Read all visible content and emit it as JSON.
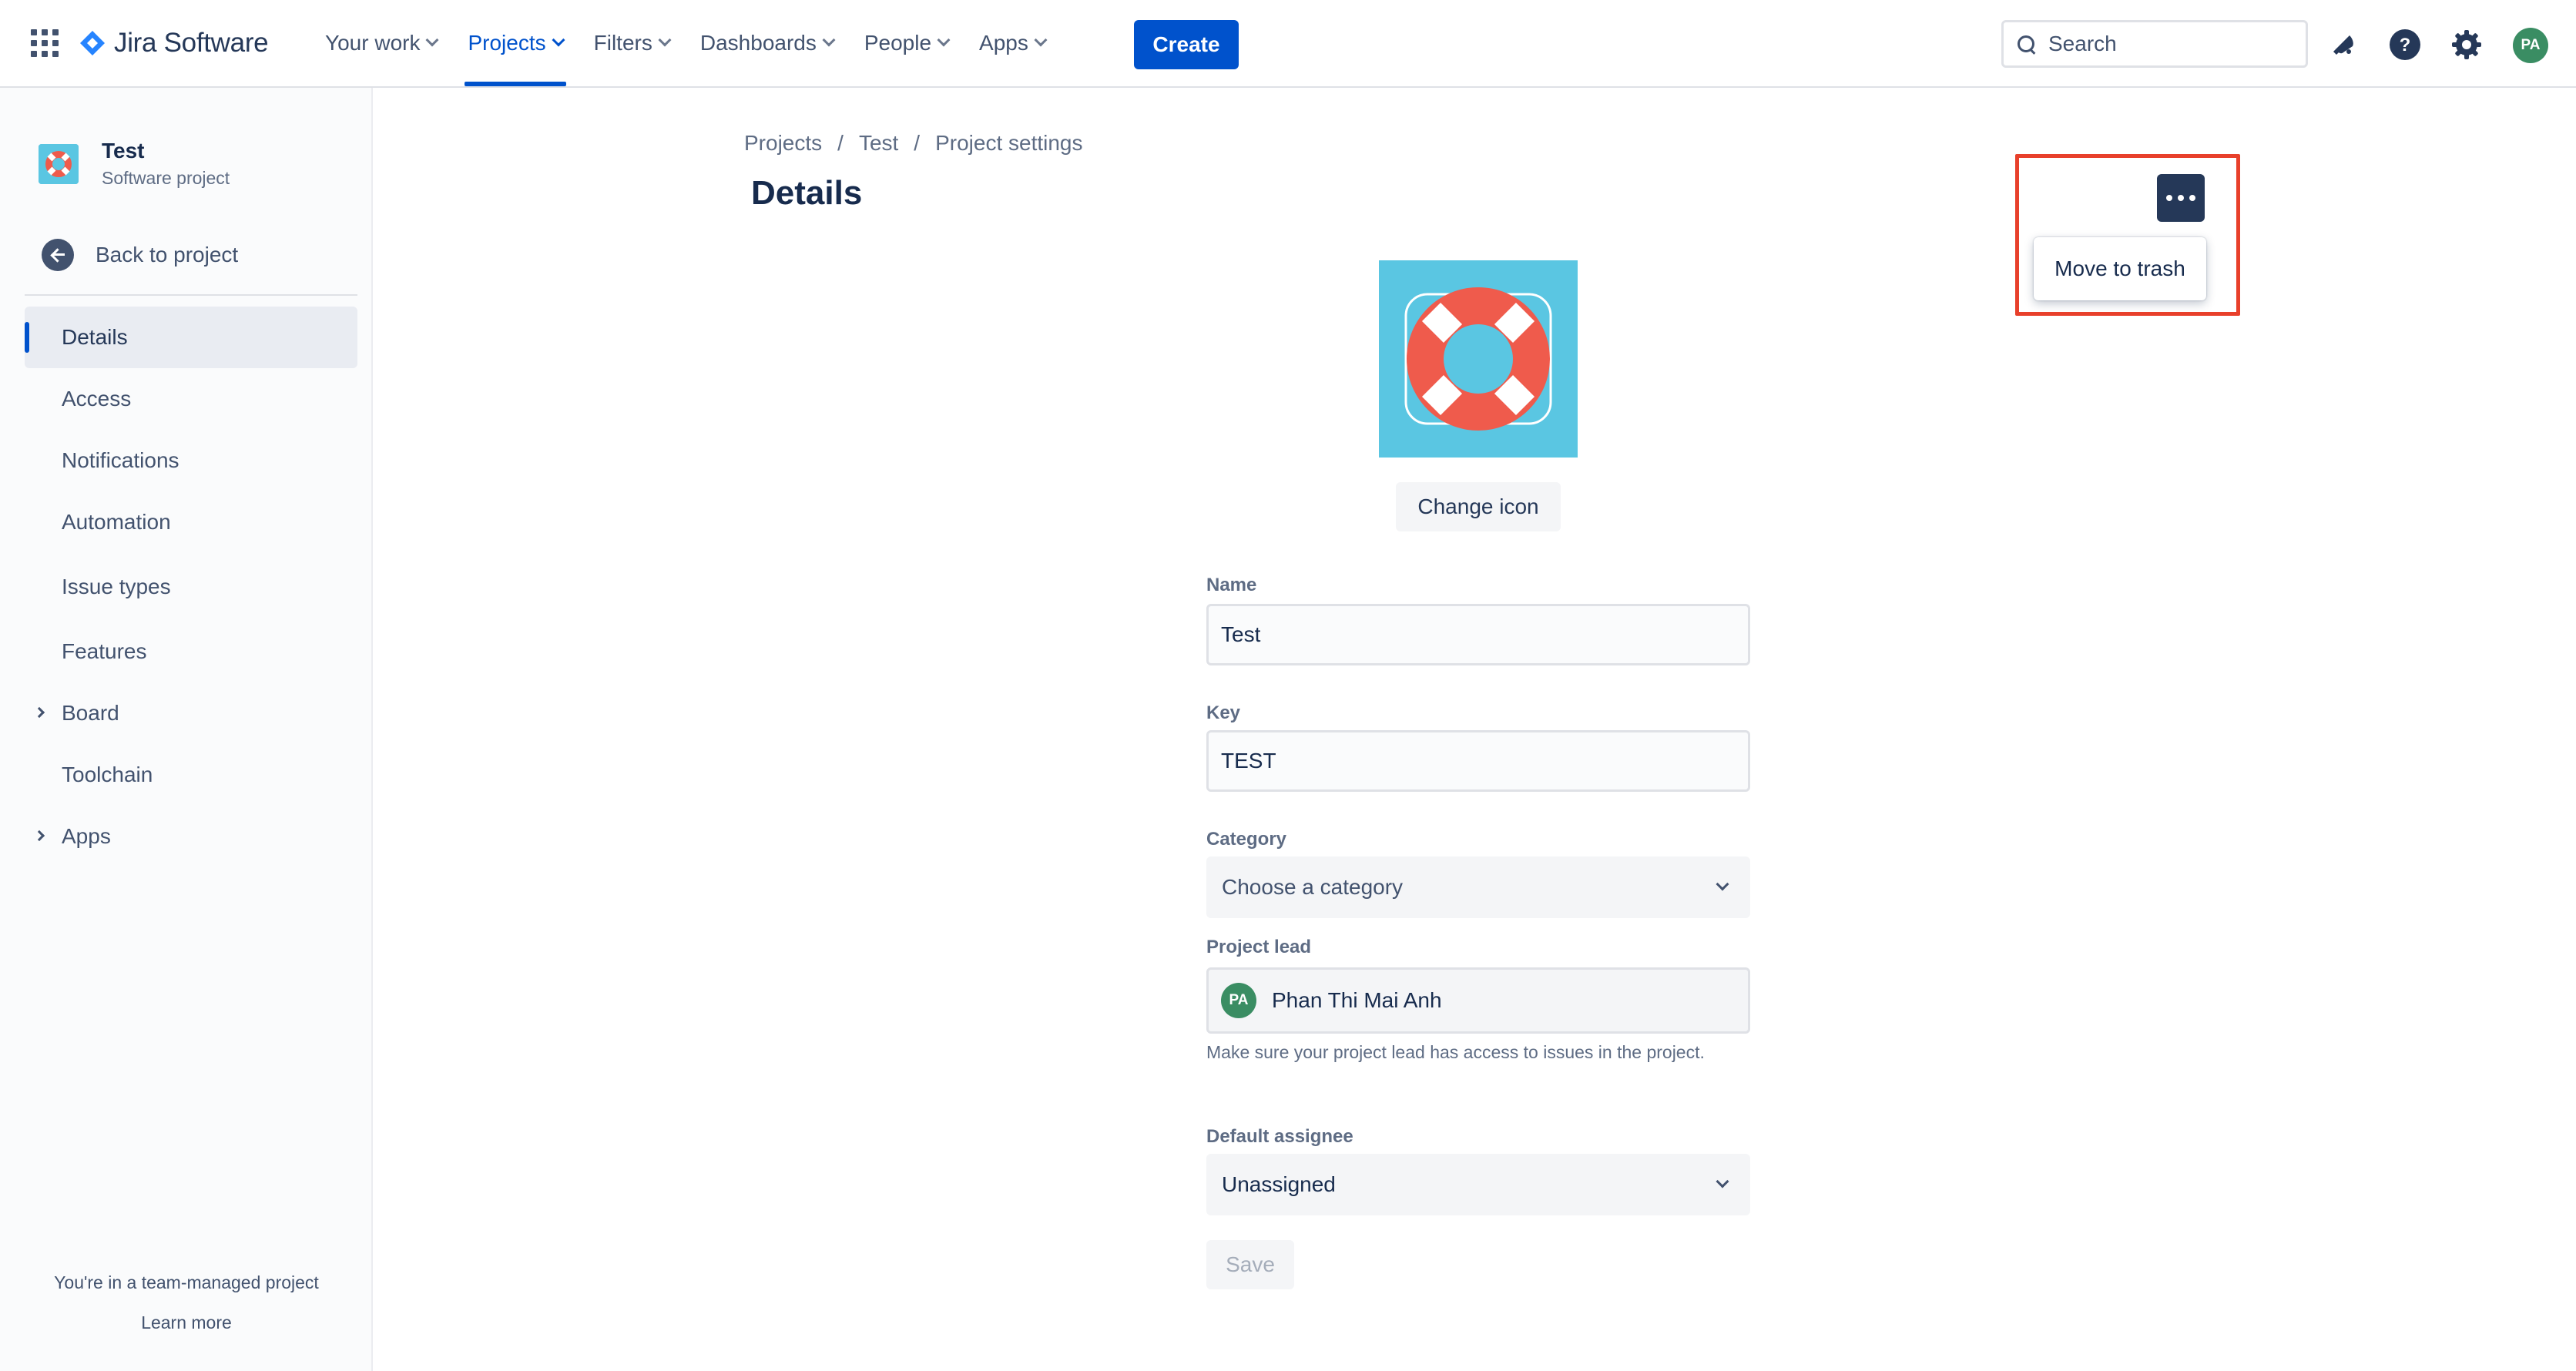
{
  "app": {
    "logo_text": "Jira Software"
  },
  "nav": {
    "items": [
      {
        "label": "Your work"
      },
      {
        "label": "Projects"
      },
      {
        "label": "Filters"
      },
      {
        "label": "Dashboards"
      },
      {
        "label": "People"
      },
      {
        "label": "Apps"
      }
    ],
    "create_label": "Create",
    "search_placeholder": "Search",
    "avatar_initials": "PA"
  },
  "sidebar": {
    "project_name": "Test",
    "project_type": "Software project",
    "back_label": "Back to project",
    "items": [
      {
        "label": "Details"
      },
      {
        "label": "Access"
      },
      {
        "label": "Notifications"
      },
      {
        "label": "Automation"
      },
      {
        "label": "Issue types"
      },
      {
        "label": "Features"
      },
      {
        "label": "Board"
      },
      {
        "label": "Toolchain"
      },
      {
        "label": "Apps"
      }
    ],
    "footer_text": "You're in a team-managed project",
    "learn_more": "Learn more"
  },
  "main": {
    "breadcrumb": [
      "Projects",
      "Test",
      "Project settings"
    ],
    "title": "Details",
    "menu_item": "Move to trash",
    "change_icon_label": "Change icon",
    "fields": {
      "name_label": "Name",
      "name_value": "Test",
      "key_label": "Key",
      "key_value": "TEST",
      "category_label": "Category",
      "category_value": "Choose a category",
      "lead_label": "Project lead",
      "lead_initials": "PA",
      "lead_name": "Phan Thi Mai Anh",
      "lead_help": "Make sure your project lead has access to issues in the project.",
      "assignee_label": "Default assignee",
      "assignee_value": "Unassigned"
    },
    "save_label": "Save"
  },
  "colors": {
    "brand": "#0052cc",
    "highlight": "#e8402b",
    "text": "#172b4d"
  }
}
